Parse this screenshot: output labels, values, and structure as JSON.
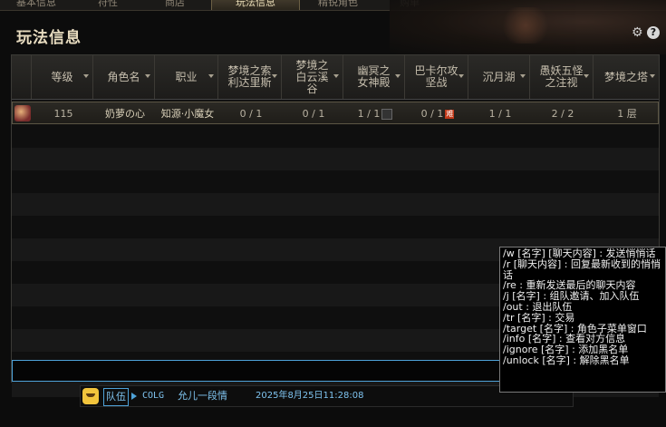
{
  "tabs": [
    {
      "label": "基本信息",
      "active": false
    },
    {
      "label": "符性",
      "active": false
    },
    {
      "label": "商店",
      "active": false
    },
    {
      "label": "玩法信息",
      "active": true
    },
    {
      "label": "精锐角色",
      "active": false
    },
    {
      "label": "购单",
      "active": false
    }
  ],
  "panel": {
    "title": "玩法信息"
  },
  "table": {
    "columns": [
      "等级",
      "角色名",
      "职业",
      "梦境之索利达里斯",
      "梦境之白云溪谷",
      "幽冥之女神殿",
      "巴卡尔攻坚战",
      "沉月湖",
      "愚妖五怪之注视",
      "梦境之塔"
    ],
    "rows": [
      {
        "level": "115",
        "name": "奶萝の心",
        "job": "知源·小魔女",
        "c1": "0 / 1",
        "c2": "0 / 1",
        "c3": "1 / 1",
        "c4": "0 / 1",
        "c5": "1 / 1",
        "c6": "2 / 2",
        "c7": "1 层",
        "c4_badge": "难"
      }
    ]
  },
  "chat": {
    "channel": "队伍",
    "server": "COLG",
    "user": "允儿一段情",
    "time": "2025年8月25日11:28:08"
  },
  "tooltip": {
    "lines": [
      "/w [名字] [聊天内容] : 发送悄悄话",
      "/r [聊天内容] : 回复最新收到的悄悄话",
      "/re : 重新发送最后的聊天内容",
      "/j [名字] : 组队邀请、加入队伍",
      "/out : 退出队伍",
      "/tr [名字] : 交易",
      "/target [名字] : 角色子菜单窗口",
      "/info [名字] : 查看对方信息",
      "/ignore [名字] : 添加黑名单",
      "/unlock [名字] : 解除黑名单"
    ]
  },
  "colors": {
    "accent": "#4ea2d8",
    "panel_bg": "#111111",
    "text": "#c9c2b4"
  }
}
